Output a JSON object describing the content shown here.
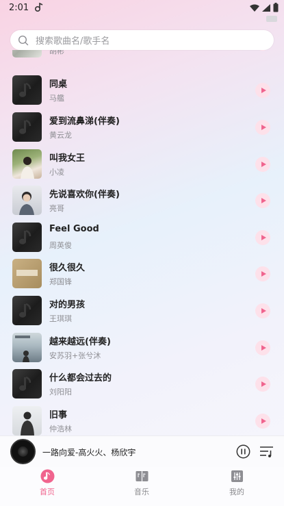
{
  "status_bar": {
    "time": "2:01"
  },
  "search": {
    "placeholder": "搜索歌曲名/歌手名"
  },
  "songs": [
    {
      "title": "",
      "artist": "胡彬",
      "cover": "photo-gray"
    },
    {
      "title": "同桌",
      "artist": "马艦",
      "cover": "default-note"
    },
    {
      "title": "爱到流鼻涕(伴奏)",
      "artist": "黄云龙",
      "cover": "default-note"
    },
    {
      "title": "叫我女王",
      "artist": "小凌",
      "cover": "photo-girl"
    },
    {
      "title": "先说喜欢你(伴奏)",
      "artist": "亮哥",
      "cover": "photo-boy"
    },
    {
      "title": "Feel Good",
      "artist": "周英俊",
      "cover": "default-note"
    },
    {
      "title": "很久很久",
      "artist": "郑国锋",
      "cover": "photo-tan"
    },
    {
      "title": "对的男孩",
      "artist": "王琪琪",
      "cover": "default-note"
    },
    {
      "title": "越来越远(伴奏)",
      "artist": "安苏羽+张兮沐",
      "cover": "photo-sky"
    },
    {
      "title": "什么都会过去的",
      "artist": "刘阳阳",
      "cover": "default-note"
    },
    {
      "title": "旧事",
      "artist": "仲浩林",
      "cover": "photo-man"
    }
  ],
  "player": {
    "now_playing": "一路向爱-高火火、杨欣宇"
  },
  "tabs": [
    {
      "label": "首页",
      "icon": "music-note-icon",
      "active": true
    },
    {
      "label": "音乐",
      "icon": "music-book-icon",
      "active": false
    },
    {
      "label": "我的",
      "icon": "mixer-icon",
      "active": false
    }
  ],
  "colors": {
    "accent": "#f0648e",
    "play_bg": "#fde1ea"
  }
}
